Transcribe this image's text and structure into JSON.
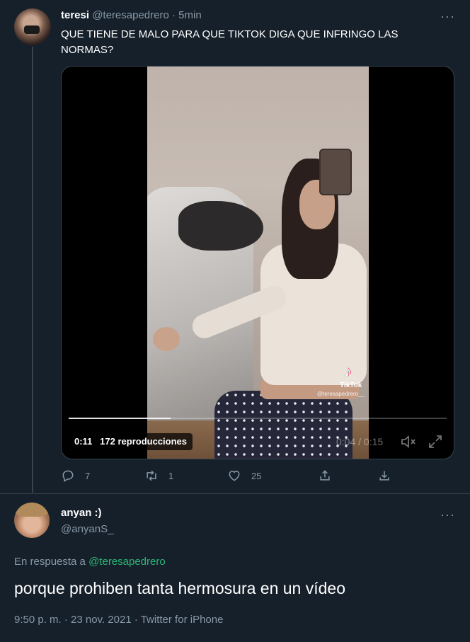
{
  "tweet": {
    "author_name": "teresi",
    "author_handle": "@teresapedrero",
    "separator": "·",
    "time": "5min",
    "more_label": "···",
    "text": "QUE TIENE DE MALO PARA QUE TIKTOK DIGA QUE INFRINGO LAS NORMAS?",
    "video": {
      "elapsed_badge": "0:11",
      "views": "172 reproducciones",
      "time_display": "0:04 / 0:15",
      "progress": 0.27,
      "watermark_word": "TikTok",
      "watermark_handle": "@teresapedrero__"
    },
    "actions": {
      "replies": "7",
      "retweets": "1",
      "likes": "25"
    }
  },
  "reply": {
    "author_name": "anyan :)",
    "author_handle": "@anyanS_",
    "more_label": "···",
    "replying_prefix": "En respuesta a",
    "replying_to": "@teresapedrero",
    "text": "porque prohiben tanta hermosura en un vídeo",
    "meta": "9:50 p. m. · 23 nov. 2021 · Twitter for iPhone"
  },
  "colors": {
    "background": "#15202b",
    "muted": "#8899a6",
    "mention": "#2bb673",
    "divider": "#38444d"
  }
}
